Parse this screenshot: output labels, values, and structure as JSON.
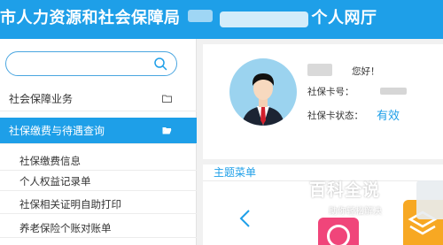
{
  "header": {
    "title_left": "市人力资源和社会保障局",
    "title_right": "个人网厅"
  },
  "sidebar": {
    "search": {
      "placeholder": "",
      "value": ""
    },
    "groups": [
      {
        "label": "社会保障业务",
        "active": false
      },
      {
        "label": "社保缴费与待遇查询",
        "active": true
      }
    ],
    "sub_items": [
      {
        "label": "社保缴费信息"
      },
      {
        "label": "个人权益记录单"
      },
      {
        "label": "社保相关证明自助打印"
      },
      {
        "label": "养老保险个账对账单"
      }
    ]
  },
  "profile": {
    "greeting": "您好！",
    "card_no_label": "社保卡号：",
    "card_status_label": "社保卡状态：",
    "card_status_value": "有效"
  },
  "main_menu": {
    "title": "主题菜单"
  },
  "watermark": {
    "title": "百科全说",
    "subtitle": "助你轻松解决"
  },
  "colors": {
    "brand_blue": "#1e9fe8",
    "tile_pink": "#f0457a",
    "tile_orange": "#f7a823"
  }
}
